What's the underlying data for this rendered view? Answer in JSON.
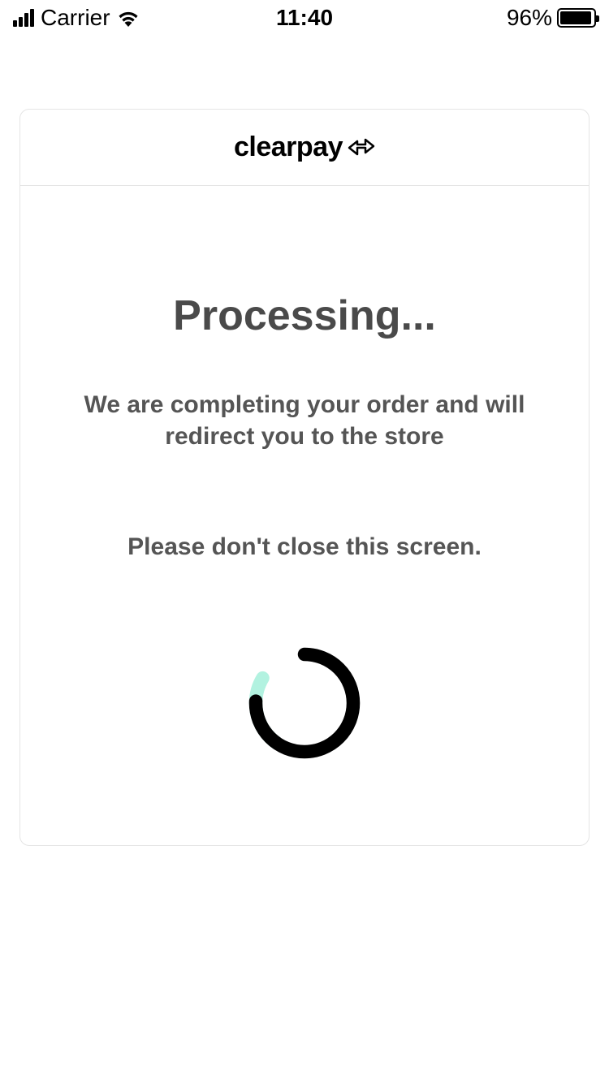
{
  "statusBar": {
    "carrier": "Carrier",
    "time": "11:40",
    "batteryPercent": "96%"
  },
  "brand": {
    "name": "clearpay"
  },
  "processing": {
    "title": "Processing...",
    "subtitle": "We are completing your order and will redirect you to the store",
    "warning": "Please don't close this screen."
  },
  "colors": {
    "accent": "#b2f2e0",
    "text": "#4a4a4a"
  }
}
